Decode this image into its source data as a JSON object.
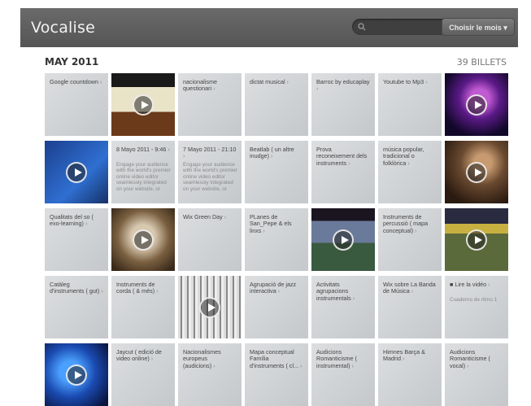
{
  "header": {
    "title": "Vocalise",
    "month_button": "Choisir le mois ▾"
  },
  "month": {
    "label": "MAY 2011",
    "count": "39 BILLETS"
  },
  "colors": {
    "header_bg": "#5e5e5e",
    "tile_bg": "#d0d3d6"
  },
  "tiles": [
    {
      "title": "Google countdown",
      "kind": "text"
    },
    {
      "title": "",
      "kind": "video",
      "icon": "sheet-music-thumb"
    },
    {
      "title": "nacionalisme questionari",
      "kind": "text"
    },
    {
      "title": "dictat musical",
      "kind": "text"
    },
    {
      "title": "Barroc by educaplay",
      "kind": "text"
    },
    {
      "title": "Youtube to Mp3",
      "kind": "text"
    },
    {
      "title": "",
      "kind": "video",
      "icon": "concert-thumb"
    },
    {
      "title": "",
      "kind": "video",
      "icon": "blue-slide-thumb"
    },
    {
      "title": "8 Mayo 2011 - 9:46",
      "sub": "Engage your audience with the world's premier online video editor seamlessly integrated on your website, or",
      "kind": "text"
    },
    {
      "title": "7 Mayo 2011 - 21:10",
      "sub": "Engage your audience with the world's premier online video editor seamlessly integrated on your website, or",
      "kind": "text"
    },
    {
      "title": "Beatlab ( un altre inudge)",
      "kind": "text"
    },
    {
      "title": "Prova reconeixement dels instruments",
      "kind": "text"
    },
    {
      "title": "música popular, tradicional o folklòrica",
      "kind": "text"
    },
    {
      "title": "",
      "kind": "video",
      "icon": "guitarist-thumb"
    },
    {
      "title": "Qualitats del so ( exo-learning)",
      "kind": "text"
    },
    {
      "title": "",
      "kind": "video",
      "icon": "portrait-thumb"
    },
    {
      "title": "Wix Green Day",
      "kind": "text"
    },
    {
      "title": "PLanes de San_Pepe & els linxs",
      "kind": "text"
    },
    {
      "title": "",
      "kind": "video",
      "icon": "stage-thumb"
    },
    {
      "title": "Instruments de percussió ( mapa conceptual)",
      "kind": "text"
    },
    {
      "title": "",
      "kind": "video",
      "icon": "crowd-thumb"
    },
    {
      "title": "Catàleg d'instruments ( gut)",
      "kind": "text"
    },
    {
      "title": "Instruments de corda ( & més)",
      "kind": "text"
    },
    {
      "title": "",
      "kind": "video",
      "icon": "bw-trees-thumb"
    },
    {
      "title": "Agrupació de jazz interactiva",
      "kind": "text"
    },
    {
      "title": "Activitats agrupacions instrumentals",
      "kind": "text"
    },
    {
      "title": "Wix sobre La Banda de Música",
      "kind": "text"
    },
    {
      "title": "■ Lire la vidéo",
      "sub": "Cuaderno de ritmo 1",
      "kind": "text"
    },
    {
      "title": "",
      "kind": "video",
      "icon": "tv-studio-thumb"
    },
    {
      "title": "Jaycut ( edició de video online)",
      "kind": "text"
    },
    {
      "title": "Nacionalismes europeus (audicions)",
      "kind": "text"
    },
    {
      "title": "Mapa conceptual Família d'instruments ( cl...",
      "kind": "text"
    },
    {
      "title": "Audicions Romanticisme ( instrumental)",
      "kind": "text"
    },
    {
      "title": "Himnes Barça & Madrid",
      "kind": "text"
    },
    {
      "title": "Audicions Romanticisme ( vocal)",
      "kind": "text"
    }
  ]
}
